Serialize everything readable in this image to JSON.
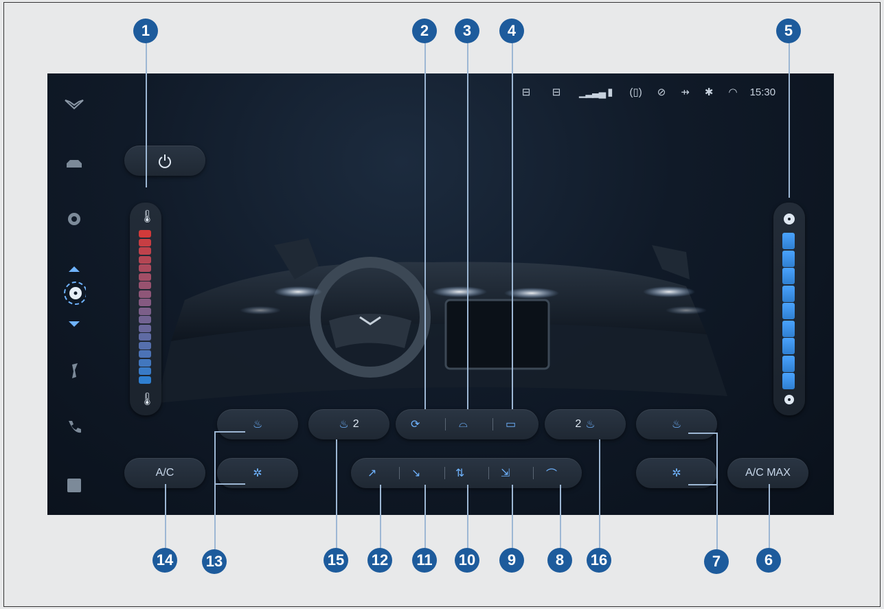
{
  "status_bar": {
    "time": "15:30",
    "icons": [
      "seat-heat-front-icon",
      "seat-heat-rear-icon",
      "signal-icon",
      "battery-icon",
      "phone-vibrate-icon",
      "mute-icon",
      "usb-icon",
      "bluetooth-icon",
      "wifi-icon"
    ]
  },
  "sidebar": {
    "items": [
      "logo-icon",
      "car-icon",
      "settings-icon",
      "climate-fan-icon",
      "music-icon",
      "phone-icon",
      "apps-icon"
    ]
  },
  "controls": {
    "ac_label": "A/C",
    "ac_max_label": "A/C MAX",
    "rear_seat_heat_left": "2",
    "rear_seat_heat_right": "2"
  },
  "callouts": [
    "1",
    "2",
    "3",
    "4",
    "5",
    "6",
    "7",
    "8",
    "9",
    "10",
    "11",
    "12",
    "13",
    "14",
    "15",
    "16"
  ],
  "temperature_slider": {
    "level_fraction": 0.5
  },
  "fan_slider": {
    "level_fraction": 1.0
  },
  "colors": {
    "accent": "#6fb3ff",
    "callout": "#1d5b9c",
    "hot": "#d23a3a",
    "cold": "#2f7fd0"
  }
}
